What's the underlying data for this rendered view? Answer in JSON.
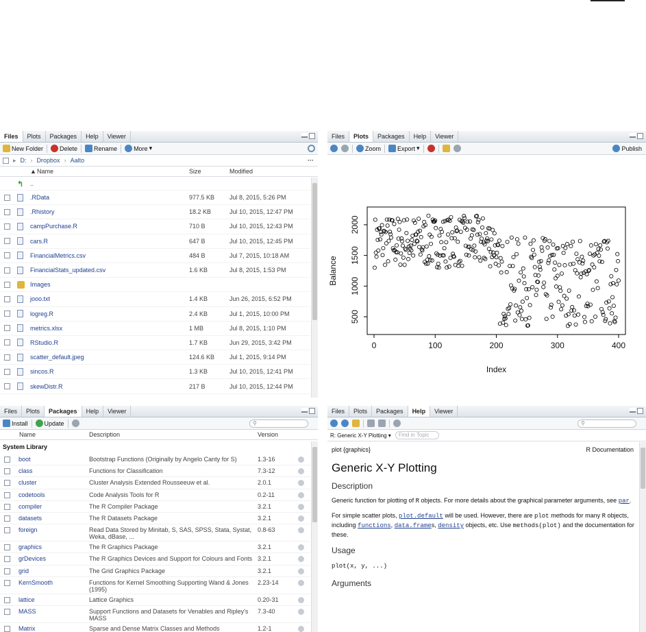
{
  "files_pane": {
    "tabs": [
      "Files",
      "Plots",
      "Packages",
      "Help",
      "Viewer"
    ],
    "active_tab": "Files",
    "toolbar": {
      "new_folder": "New Folder",
      "delete": "Delete",
      "rename": "Rename",
      "more": "More"
    },
    "path": [
      "D:",
      "Dropbox",
      "Aalto"
    ],
    "columns": {
      "name": "Name",
      "size": "Size",
      "modified": "Modified"
    },
    "up_label": "..",
    "files": [
      {
        "name": ".RData",
        "size": "977.5 KB",
        "modified": "Jul 8, 2015, 5:26 PM"
      },
      {
        "name": ".Rhistory",
        "size": "18.2 KB",
        "modified": "Jul 10, 2015, 12:47 PM"
      },
      {
        "name": "campPurchase.R",
        "size": "710 B",
        "modified": "Jul 10, 2015, 12:43 PM"
      },
      {
        "name": "cars.R",
        "size": "647 B",
        "modified": "Jul 10, 2015, 12:45 PM"
      },
      {
        "name": "FinancialMetrics.csv",
        "size": "484 B",
        "modified": "Jul 7, 2015, 10:18 AM"
      },
      {
        "name": "FinancialStats_updated.csv",
        "size": "1.6 KB",
        "modified": "Jul 8, 2015, 1:53 PM"
      },
      {
        "name": "Images",
        "size": "",
        "modified": ""
      },
      {
        "name": "jooo.txt",
        "size": "1.4 KB",
        "modified": "Jun 26, 2015, 6:52 PM"
      },
      {
        "name": "logreg.R",
        "size": "2.4 KB",
        "modified": "Jul 1, 2015, 10:00 PM"
      },
      {
        "name": "metrics.xlsx",
        "size": "1 MB",
        "modified": "Jul 8, 2015, 1:10 PM"
      },
      {
        "name": "RStudio.R",
        "size": "1.7 KB",
        "modified": "Jun 29, 2015, 3:42 PM"
      },
      {
        "name": "scatter_default.jpeg",
        "size": "124.6 KB",
        "modified": "Jul 1, 2015, 9:14 PM"
      },
      {
        "name": "sincos.R",
        "size": "1.3 KB",
        "modified": "Jul 10, 2015, 12:41 PM"
      },
      {
        "name": "skewDistr.R",
        "size": "217 B",
        "modified": "Jul 10, 2015, 12:44 PM"
      }
    ]
  },
  "plots_pane": {
    "tabs": [
      "Files",
      "Plots",
      "Packages",
      "Help",
      "Viewer"
    ],
    "active_tab": "Plots",
    "toolbar": {
      "zoom": "Zoom",
      "export": "Export",
      "publish": "Publish"
    },
    "plot": {
      "xlabel": "Index",
      "ylabel": "Balance",
      "xticks": [
        "0",
        "100",
        "200",
        "300",
        "400"
      ],
      "yticks": [
        "500",
        "1000",
        "1500",
        "2000"
      ],
      "xlim": [
        0,
        400
      ],
      "ylim": [
        300,
        2200
      ],
      "seed": 7,
      "n": 400
    }
  },
  "packages_pane": {
    "tabs": [
      "Files",
      "Plots",
      "Packages",
      "Help",
      "Viewer"
    ],
    "active_tab": "Packages",
    "toolbar": {
      "install": "Install",
      "update": "Update"
    },
    "columns": {
      "name": "Name",
      "description": "Description",
      "version": "Version"
    },
    "section": "System Library",
    "packages": [
      {
        "name": "boot",
        "description": "Bootstrap Functions (Originally by Angelo Canty for S)",
        "version": "1.3-16"
      },
      {
        "name": "class",
        "description": "Functions for Classification",
        "version": "7.3-12"
      },
      {
        "name": "cluster",
        "description": "Cluster Analysis Extended Rousseeuw et al.",
        "version": "2.0.1"
      },
      {
        "name": "codetools",
        "description": "Code Analysis Tools for R",
        "version": "0.2-11"
      },
      {
        "name": "compiler",
        "description": "The R Compiler Package",
        "version": "3.2.1"
      },
      {
        "name": "datasets",
        "description": "The R Datasets Package",
        "version": "3.2.1"
      },
      {
        "name": "foreign",
        "description": "Read Data Stored by Minitab, S, SAS, SPSS, Stata, Systat, Weka, dBase, ...",
        "version": "0.8-63"
      },
      {
        "name": "graphics",
        "description": "The R Graphics Package",
        "version": "3.2.1"
      },
      {
        "name": "grDevices",
        "description": "The R Graphics Devices and Support for Colours and Fonts",
        "version": "3.2.1"
      },
      {
        "name": "grid",
        "description": "The Grid Graphics Package",
        "version": "3.2.1"
      },
      {
        "name": "KernSmooth",
        "description": "Functions for Kernel Smoothing Supporting Wand & Jones (1995)",
        "version": "2.23-14"
      },
      {
        "name": "lattice",
        "description": "Lattice Graphics",
        "version": "0.20-31"
      },
      {
        "name": "MASS",
        "description": "Support Functions and Datasets for Venables and Ripley's MASS",
        "version": "7.3-40"
      },
      {
        "name": "Matrix",
        "description": "Sparse and Dense Matrix Classes and Methods",
        "version": "1.2-1"
      }
    ]
  },
  "help_pane": {
    "tabs": [
      "Files",
      "Plots",
      "Packages",
      "Help",
      "Viewer"
    ],
    "active_tab": "Help",
    "topic_select": "R: Generic X-Y Plotting",
    "find_placeholder": "Find in Topic",
    "doc_left": "plot {graphics}",
    "doc_right": "R Documentation",
    "title": "Generic X-Y Plotting",
    "h_description": "Description",
    "p1_a": "Generic function for plotting of",
    "p1_code": "R",
    "p1_b": "objects. For more details about the graphical parameter arguments, see",
    "p1_link": "par",
    "p1_c": ".",
    "p2_a": "For simple scatter plots,",
    "p2_link1": "plot.default",
    "p2_b": "will be used. However, there are",
    "p2_code1": "plot",
    "p2_c": "methods for many",
    "p2_code2": "R",
    "p2_d": "objects, including",
    "p2_link2": "functions",
    "p2_e": ",",
    "p2_link3": "data.frame",
    "p2_f": "s,",
    "p2_link4": "density",
    "p2_g": "objects, etc. Use",
    "p2_code3": "methods(plot)",
    "p2_h": "and the documentation for these.",
    "h_usage": "Usage",
    "usage_code": "plot(x, y, ...)",
    "h_arguments": "Arguments"
  }
}
